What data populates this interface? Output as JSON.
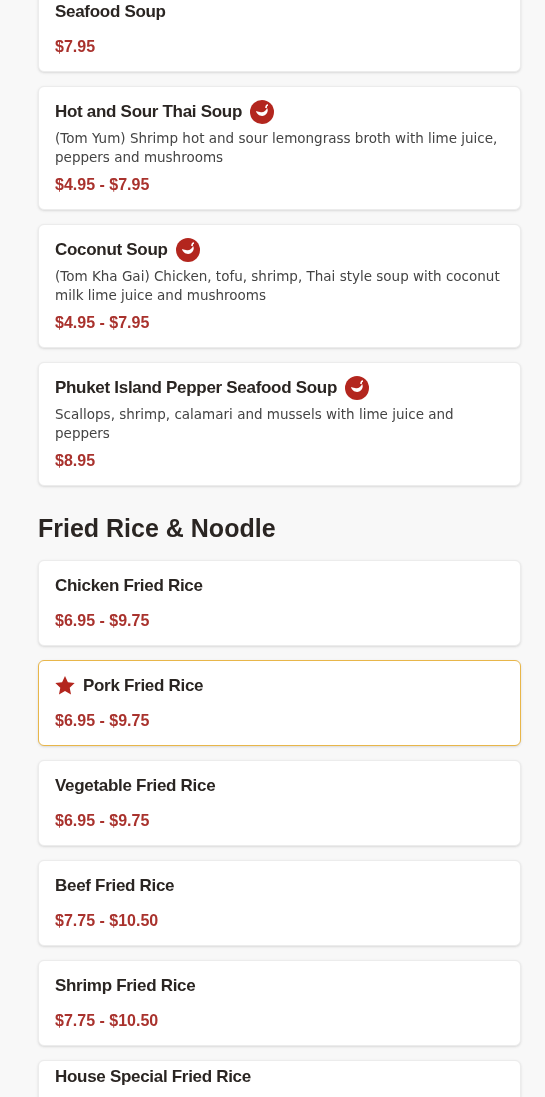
{
  "sections": [
    {
      "items": [
        {
          "name": "Seafood Soup",
          "price": "$7.95",
          "spicy": false,
          "featured": false
        },
        {
          "name": "Hot and Sour Thai Soup",
          "description": "(Tom Yum) Shrimp hot and sour lemongrass broth with lime juice, peppers and mushrooms",
          "price": "$4.95 - $7.95",
          "spicy": true,
          "featured": false
        },
        {
          "name": "Coconut Soup",
          "description": "(Tom Kha Gai) Chicken, tofu, shrimp, Thai style soup with coconut milk lime juice and mushrooms",
          "price": "$4.95 - $7.95",
          "spicy": true,
          "featured": false
        },
        {
          "name": "Phuket Island Pepper Seafood Soup",
          "description": "Scallops, shrimp, calamari and mussels with lime juice and peppers",
          "price": "$8.95",
          "spicy": true,
          "featured": false
        }
      ]
    },
    {
      "title": "Fried Rice & Noodle",
      "items": [
        {
          "name": "Chicken Fried Rice",
          "price": "$6.95 - $9.75",
          "spicy": false,
          "featured": false
        },
        {
          "name": "Pork Fried Rice",
          "price": "$6.95 - $9.75",
          "spicy": false,
          "featured": true
        },
        {
          "name": "Vegetable Fried Rice",
          "price": "$6.95 - $9.75",
          "spicy": false,
          "featured": false
        },
        {
          "name": "Beef Fried Rice",
          "price": "$7.75 - $10.50",
          "spicy": false,
          "featured": false
        },
        {
          "name": "Shrimp Fried Rice",
          "price": "$7.75 - $10.50",
          "spicy": false,
          "featured": false
        },
        {
          "name": "House Special Fried Rice"
        }
      ]
    }
  ]
}
